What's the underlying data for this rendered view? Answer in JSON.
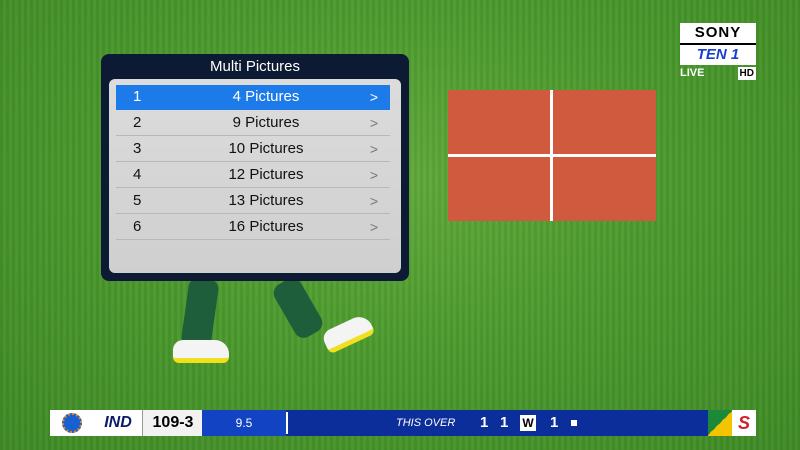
{
  "menu": {
    "title": "Multi Pictures",
    "items": [
      {
        "num": "1",
        "label": "4 Pictures",
        "arrow": ">",
        "selected": true
      },
      {
        "num": "2",
        "label": "9 Pictures",
        "arrow": ">",
        "selected": false
      },
      {
        "num": "3",
        "label": "10 Pictures",
        "arrow": ">",
        "selected": false
      },
      {
        "num": "4",
        "label": "12 Pictures",
        "arrow": ">",
        "selected": false
      },
      {
        "num": "5",
        "label": "13 Pictures",
        "arrow": ">",
        "selected": false
      },
      {
        "num": "6",
        "label": "16 Pictures",
        "arrow": ">",
        "selected": false
      }
    ]
  },
  "preview": {
    "layout": "2x2 grid",
    "color": "#d05a3e"
  },
  "channel": {
    "brand": "SONY",
    "name": "TEN 1",
    "live": "LIVE",
    "hd": "HD"
  },
  "scorebar": {
    "team": "IND",
    "score": "109-3",
    "overs": "9.5",
    "this_over_label": "THIS OVER",
    "balls": [
      "1",
      "1",
      "W",
      "1"
    ],
    "sponsor_icon": "s-logo-icon",
    "opponent_icon": "south-africa-logo-icon"
  },
  "colors": {
    "selection": "#1c7be8",
    "menu_frame": "#0d1a33",
    "scorebar": "#0c2e9a",
    "pitch": "#4c9a2e"
  }
}
